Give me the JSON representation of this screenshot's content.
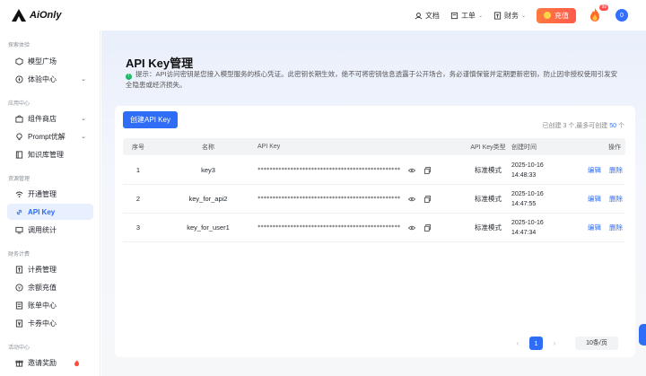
{
  "brand": {
    "name": "AiOnly"
  },
  "header": {
    "docs": "文档",
    "tickets": "工单",
    "finance": "财务",
    "recharge": "充值",
    "notify_count": "99",
    "avatar_text": "0"
  },
  "sidebar": {
    "groups": [
      {
        "title": "探索体验",
        "items": [
          {
            "label": "模型广场"
          },
          {
            "label": "体验中心"
          }
        ]
      },
      {
        "title": "应用中心",
        "items": [
          {
            "label": "组件商店"
          },
          {
            "label": "Prompt优解"
          },
          {
            "label": "知识库管理"
          }
        ]
      },
      {
        "title": "资源管理",
        "items": [
          {
            "label": "开通管理"
          },
          {
            "label": "API Key"
          },
          {
            "label": "调用统计"
          }
        ]
      },
      {
        "title": "财务计费",
        "items": [
          {
            "label": "计费管理"
          },
          {
            "label": "余额充值"
          },
          {
            "label": "账单中心"
          },
          {
            "label": "卡券中心"
          }
        ]
      },
      {
        "title": "活动中心",
        "items": [
          {
            "label": "邀请奖励"
          }
        ]
      }
    ]
  },
  "page": {
    "title": "API Key管理",
    "tip": "提示：API访问密钥是您接入模型服务的核心凭证。此密钥长期生效，绝不可将密钥信息透露于公开场合，务必谨慎保管并定期更新密钥，防止因非授权使用引发安全隐患或经济损失。",
    "create_button": "创建API Key",
    "quota_prefix": "已创建",
    "quota_created": "3",
    "quota_mid": "个,最多可创建",
    "quota_max": "50",
    "quota_suffix": "个"
  },
  "table": {
    "headers": {
      "index": "序号",
      "name": "名称",
      "key": "API Key",
      "type": "API Key类型",
      "time": "创建时间",
      "ops": "操作"
    },
    "rows": [
      {
        "index": "1",
        "name": "key3",
        "key": "************************************************",
        "type": "标准模式",
        "date": "2025-10-16",
        "time": "14:48:33"
      },
      {
        "index": "2",
        "name": "key_for_api2",
        "key": "************************************************",
        "type": "标准模式",
        "date": "2025-10-16",
        "time": "14:47:55"
      },
      {
        "index": "3",
        "name": "key_for_user1",
        "key": "************************************************",
        "type": "标准模式",
        "date": "2025-10-16",
        "time": "14:47:34"
      }
    ],
    "edit_label": "编辑",
    "delete_label": "删除"
  },
  "pagination": {
    "current": "1",
    "page_size": "10条/页"
  },
  "colors": {
    "primary": "#2f6df6",
    "recharge": "#ff6a44",
    "active_bg": "#e8efff"
  }
}
